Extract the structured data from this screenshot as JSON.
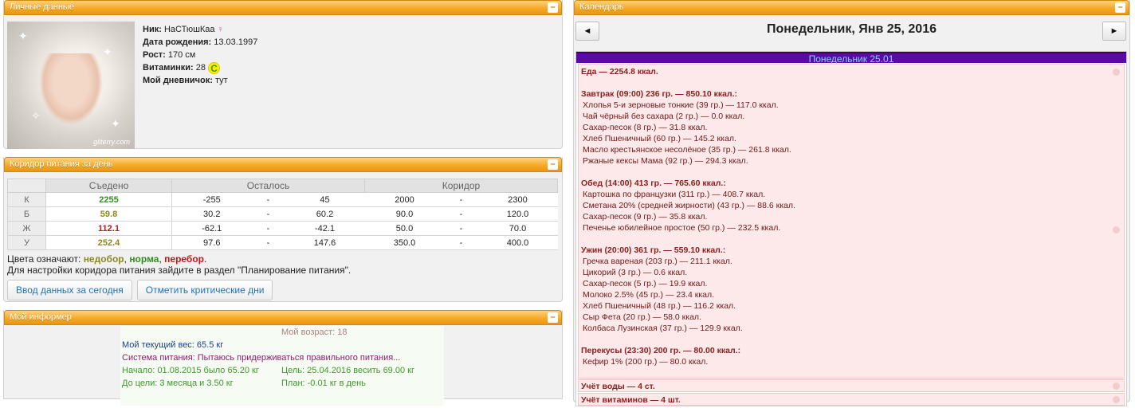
{
  "personal": {
    "title": "Личные данные",
    "avatar_watermark": "gliterry.com",
    "nick_label": "Ник:",
    "nick": "НаСТюшКаа",
    "birth_label": "Дата рождения:",
    "birth": "13.03.1997",
    "height_label": "Рост:",
    "height": "170 см",
    "vitamins_label": "Витаминки:",
    "vitamins": "28",
    "vitamin_badge": "C",
    "diary_label": "Мой дневничок:",
    "diary": "тут"
  },
  "corridor": {
    "title": "Коридор питания за день",
    "headers": [
      "Съедено",
      "Осталось",
      "Коридор"
    ],
    "rows": [
      {
        "label": "К",
        "eaten": "2255",
        "eaten_class": "ok",
        "rem_from": "-255",
        "rem_to": "45",
        "cor_from": "2000",
        "cor_to": "2300"
      },
      {
        "label": "Б",
        "eaten": "59.8",
        "eaten_class": "under",
        "rem_from": "30.2",
        "rem_to": "60.2",
        "cor_from": "90.0",
        "cor_to": "120.0"
      },
      {
        "label": "Ж",
        "eaten": "112.1",
        "eaten_class": "over",
        "rem_from": "-62.1",
        "rem_to": "-42.1",
        "cor_from": "50.0",
        "cor_to": "70.0"
      },
      {
        "label": "У",
        "eaten": "252.4",
        "eaten_class": "under",
        "rem_from": "97.6",
        "rem_to": "147.6",
        "cor_from": "350.0",
        "cor_to": "400.0"
      }
    ],
    "dash": "-",
    "legend_prefix": "Цвета означают:",
    "legend_under": "недобор",
    "legend_ok": "норма",
    "legend_over": "перебор",
    "hint": "Для настройки коридора питания зайдите в раздел \"Планирование питания\".",
    "btn_today": "Ввод данных за сегодня",
    "btn_critical": "Отметить критические дни"
  },
  "informer": {
    "title": "Мой информер",
    "age": "Мой возраст: 18",
    "weight": "Мой текущий вес: 65.5 кг",
    "system": "Система питания: Пытаюсь придерживаться правильного питания...",
    "start": "Начало: 01.08.2015 было 65.20 кг",
    "goal": "Цель: 25.04.2016 весить 69.00 кг",
    "to_goal": "До цели: 3 месяца и 3.50 кг",
    "plan": "План: -0.01 кг в день",
    "colors": {
      "age": "#b08080",
      "weight": "#1b3f8f",
      "system": "#8e1d6f",
      "start": "#3b9b25",
      "goal": "#3b9b25",
      "to_goal": "#3b9b25",
      "plan": "#3b9b25"
    }
  },
  "calendar": {
    "title": "Календарь",
    "prev": "◄",
    "next": "►",
    "date_title": "Понедельник, Янв 25, 2016",
    "day_header": "Понедельник 25.01",
    "food_total": "Еда — 2254.8 ккал.",
    "meals": [
      {
        "header": "Завтрак (09:00) 236 гр. — 850.10 ккал.:",
        "items": [
          "Хлопья 5-и зерновые тонкие (39 гр.) — 117.0 ккал.",
          "Чай чёрный без сахара (2 гр.) — 0.0 ккал.",
          "Сахар-песок (8 гр.) — 31.8 ккал.",
          "Хлеб Пшеничный (60 гр.) — 145.2 ккал.",
          "Масло крестьянское несолёное (35 гр.) — 261.8 ккал.",
          "Ржаные кексы Мама (92 гр.) — 294.3 ккал."
        ]
      },
      {
        "header": "Обед (14:00) 413 гр. — 765.60 ккал.:",
        "items": [
          "Картошка по французки (311 гр.) — 408.7 ккал.",
          "Сметана 20% (средней жирности) (43 гр.) — 88.6 ккал.",
          "Сахар-песок (9 гр.) — 35.8 ккал.",
          "Печенье юбилейное простое (50 гр.) — 232.5 ккал."
        ]
      },
      {
        "header": "Ужин (20:00) 361 гр. — 559.10 ккал.:",
        "items": [
          "Гречка вареная (203 гр.) — 211.1 ккал.",
          "Цикорий (3 гр.) — 0.6 ккал.",
          "Сахар-песок (5 гр.) — 19.9 ккал.",
          "Молоко 2.5% (45 гр.) — 23.4 ккал.",
          "Хлеб Пшеничный (48 гр.) — 116.2 ккал.",
          "Сыр Фета (20 гр.) — 58.0 ккал.",
          "Колбаса Лузинская (37 гр.) — 129.9 ккал."
        ]
      },
      {
        "header": "Перекусы (23:30) 200 гр. — 80.00 ккал.:",
        "items": [
          "Кефир 1% (200 гр.) — 80.0 ккал."
        ]
      }
    ],
    "water": "Учёт воды — 4 ст.",
    "vitamins": "Учёт витаминов — 4 шт."
  }
}
